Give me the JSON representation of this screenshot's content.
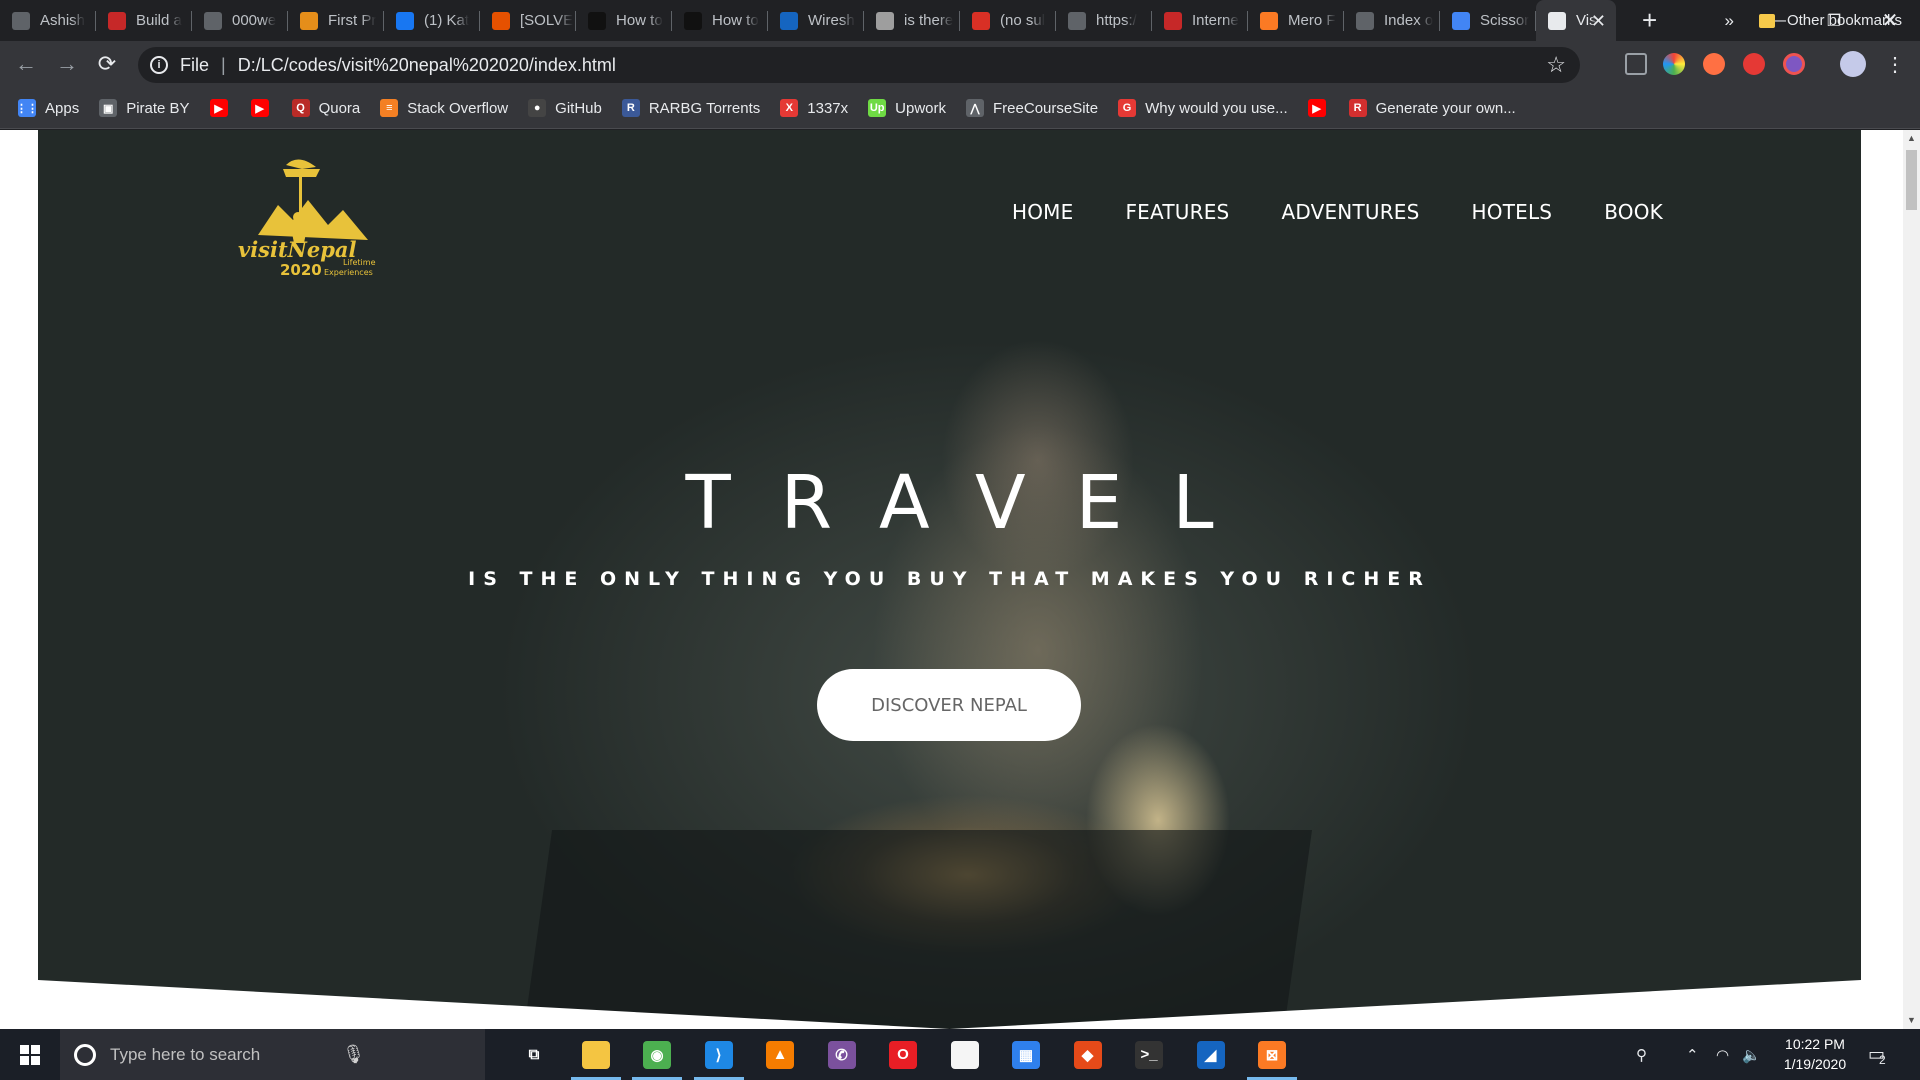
{
  "browser": {
    "tabs": [
      {
        "title": "Ashish",
        "fav_color": "#5f6368",
        "icon": "user-icon"
      },
      {
        "title": "Build a",
        "fav_color": "#c62828",
        "icon": "c-icon"
      },
      {
        "title": "000we",
        "fav_color": "#5f6368",
        "icon": "globe-icon"
      },
      {
        "title": "First Pr",
        "fav_color": "#e58e1a",
        "icon": "pinwheel-icon"
      },
      {
        "title": "(1) Kat",
        "fav_color": "#1877f2",
        "icon": "facebook-icon"
      },
      {
        "title": "[SOLVE",
        "fav_color": "#e65100",
        "icon": "ubuntu-icon"
      },
      {
        "title": "How to",
        "fav_color": "#111111",
        "icon": "htg-icon"
      },
      {
        "title": "How to",
        "fav_color": "#111111",
        "icon": "htg-icon"
      },
      {
        "title": "Wiresh",
        "fav_color": "#1565c0",
        "icon": "wireshark-icon"
      },
      {
        "title": "is there",
        "fav_color": "#9e9e9e",
        "icon": "page-icon"
      },
      {
        "title": "(no sul",
        "fav_color": "#d93025",
        "icon": "gmail-icon"
      },
      {
        "title": "https:/",
        "fav_color": "#5f6368",
        "icon": "globe-icon"
      },
      {
        "title": "Interne",
        "fav_color": "#c62828",
        "icon": "speedometer-icon"
      },
      {
        "title": "Mero F",
        "fav_color": "#fb7a24",
        "icon": "xampp-icon"
      },
      {
        "title": "Index o",
        "fav_color": "#5f6368",
        "icon": "globe-icon"
      },
      {
        "title": "Scissor",
        "fav_color": "#4285f4",
        "icon": "google-icon"
      }
    ],
    "active_tab": {
      "title": "Vis"
    },
    "new_tab_symbol": "+",
    "window_controls": {
      "minimize": "—",
      "restore": "❐",
      "close": "✕"
    },
    "nav": {
      "back": "←",
      "forward": "→",
      "reload": "⟳"
    },
    "omnibox": {
      "scheme_label": "File",
      "separator": "|",
      "url": "D:/LC/codes/visit%20nepal%202020/index.html",
      "star": "☆"
    },
    "bookmarks": [
      {
        "label": "Apps",
        "color": "#4285f4",
        "icon": "apps-grid-icon",
        "glyph": "⋮⋮"
      },
      {
        "label": "Pirate BY",
        "color": "#5f6368",
        "icon": "monitor-icon",
        "glyph": "▣"
      },
      {
        "label": "",
        "color": "#ff0000",
        "icon": "youtube-icon",
        "glyph": "▶"
      },
      {
        "label": "",
        "color": "#ff0000",
        "icon": "youtube-icon",
        "glyph": "▶"
      },
      {
        "label": "Quora",
        "color": "#b92b27",
        "icon": "quora-icon",
        "glyph": "Q"
      },
      {
        "label": "Stack Overflow",
        "color": "#f48024",
        "icon": "stackoverflow-icon",
        "glyph": "≡"
      },
      {
        "label": "GitHub",
        "color": "#444444",
        "icon": "github-icon",
        "glyph": "●"
      },
      {
        "label": "RARBG Torrents",
        "color": "#3b5998",
        "icon": "rarbg-icon",
        "glyph": "R"
      },
      {
        "label": "1337x",
        "color": "#e53935",
        "icon": "1337x-icon",
        "glyph": "X"
      },
      {
        "label": "Upwork",
        "color": "#6fda44",
        "icon": "upwork-icon",
        "glyph": "Up"
      },
      {
        "label": "FreeCourseSite",
        "color": "#5f6368",
        "icon": "freecourse-icon",
        "glyph": "⋀"
      },
      {
        "label": "Why would you use...",
        "color": "#e53935",
        "icon": "g-icon",
        "glyph": "G"
      },
      {
        "label": "",
        "color": "#ff0000",
        "icon": "youtube-icon",
        "glyph": "▶"
      },
      {
        "label": "Generate your own...",
        "color": "#d32f2f",
        "icon": "r-icon",
        "glyph": "R"
      }
    ],
    "bookmarks_more": "»",
    "other_bookmarks": "Other bookmarks"
  },
  "page": {
    "logo_text": "visitNepal",
    "logo_year": "2020",
    "logo_tagline_1": "Lifetime",
    "logo_tagline_2": "Experiences",
    "logo_color": "#e8c23a",
    "nav": [
      "HOME",
      "FEATURES",
      "ADVENTURES",
      "HOTELS",
      "BOOK"
    ],
    "headline": "TRAVEL",
    "subheadline": "IS THE ONLY THING YOU BUY THAT MAKES YOU RICHER",
    "cta": "DISCOVER NEPAL"
  },
  "taskbar": {
    "search_placeholder": "Type here to search",
    "apps": [
      {
        "icon": "task-view-icon",
        "color": "transparent",
        "glyph": "⧉",
        "running": false
      },
      {
        "icon": "file-explorer-icon",
        "color": "#f4c542",
        "glyph": "",
        "running": true
      },
      {
        "icon": "chrome-icon",
        "color": "#4caf50",
        "glyph": "◉",
        "running": true
      },
      {
        "icon": "vscode-icon",
        "color": "#1e88e5",
        "glyph": "⟩",
        "running": true
      },
      {
        "icon": "vlc-icon",
        "color": "#f57c00",
        "glyph": "▲",
        "running": false
      },
      {
        "icon": "viber-icon",
        "color": "#7b519d",
        "glyph": "✆",
        "running": false
      },
      {
        "icon": "opera-icon",
        "color": "#e81e25",
        "glyph": "O",
        "running": false
      },
      {
        "icon": "notepad-icon",
        "color": "#f5f5f5",
        "glyph": "",
        "running": false
      },
      {
        "icon": "store-icon",
        "color": "#2f80ed",
        "glyph": "▦",
        "running": false
      },
      {
        "icon": "git-icon",
        "color": "#e64a19",
        "glyph": "◆",
        "running": false
      },
      {
        "icon": "terminal-icon",
        "color": "#333333",
        "glyph": ">_",
        "running": false
      },
      {
        "icon": "wireshark-icon",
        "color": "#1565c0",
        "glyph": "◢",
        "running": false
      },
      {
        "icon": "xampp-icon",
        "color": "#fb7a24",
        "glyph": "⊠",
        "running": true
      }
    ],
    "time": "10:22 PM",
    "date": "1/19/2020",
    "notification_count": "2"
  }
}
